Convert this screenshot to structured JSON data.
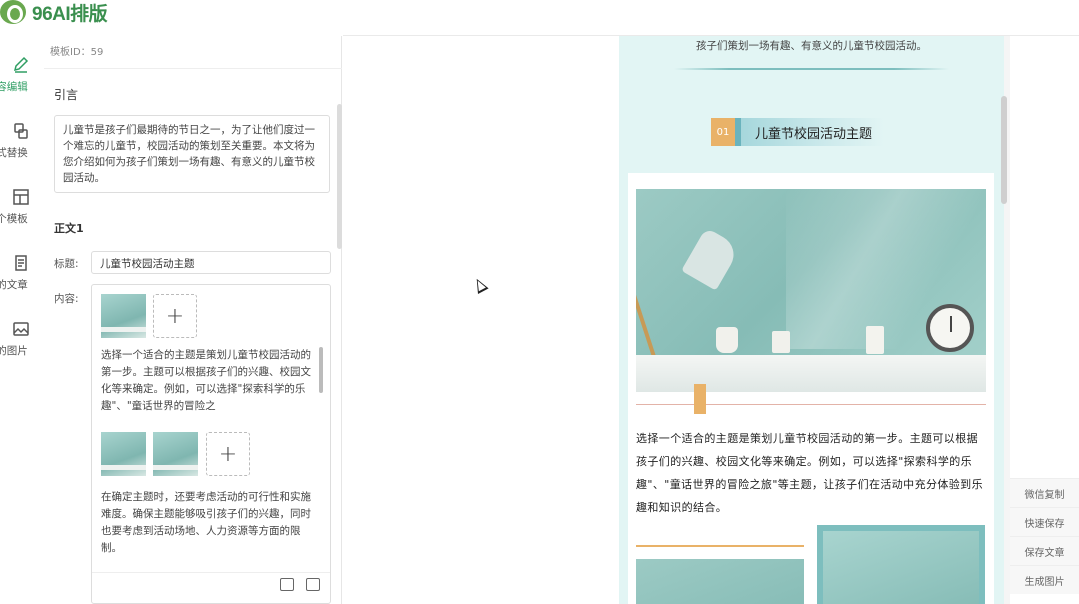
{
  "app": {
    "logo_text": "96AI排版",
    "accent_color": "#2f9e63"
  },
  "rail": {
    "items": [
      {
        "label": "容编辑",
        "icon": "pen-icon",
        "active": true
      },
      {
        "label": "式替换",
        "icon": "swap-icon",
        "active": false
      },
      {
        "label": "个模板",
        "icon": "template-icon",
        "active": false
      },
      {
        "label": "的文章",
        "icon": "article-icon",
        "active": false
      },
      {
        "label": "的图片",
        "icon": "image-icon",
        "active": false
      }
    ]
  },
  "editor": {
    "layout_id": "模板ID：59",
    "intro_heading": "引言",
    "intro_text": "儿童节是孩子们最期待的节日之一，为了让他们度过一个难忘的儿童节，校园活动的策划至关重要。本文将为您介绍如何为孩子们策划一场有趣、有意义的儿童节校园活动。",
    "section_heading": "正文1",
    "title_label": "标题:",
    "title_value": "儿童节校园活动主题",
    "content_label": "内容:",
    "para1": "选择一个适合的主题是策划儿童节校园活动的第一步。主题可以根据孩子们的兴趣、校园文化等来确定。例如，可以选择\"探索科学的乐趣\"、\"童话世界的冒险之",
    "para2": "在确定主题时，还要考虑活动的可行性和实施难度。确保主题能够吸引孩子们的兴趣，同时也要考虑到活动场地、人力资源等方面的限制。",
    "add_symbol": "+"
  },
  "preview": {
    "top_text": "孩子们策划一场有趣、有意义的儿童节校园活动。",
    "heading_number": "01",
    "heading_title": "儿童节校园活动主题",
    "body_text": "选择一个适合的主题是策划儿童节校园活动的第一步。主题可以根据孩子们的兴趣、校园文化等来确定。例如，可以选择\"探索科学的乐趣\"、\"童话世界的冒险之旅\"等主题，让孩子们在活动中充分体验到乐趣和知识的结合。",
    "theme_colors": {
      "background": "#e2f5f4",
      "accent": "#e9b268",
      "teal": "#7dbebe"
    }
  },
  "side_actions": [
    "微信复制",
    "快速保存",
    "保存文章",
    "生成图片"
  ]
}
